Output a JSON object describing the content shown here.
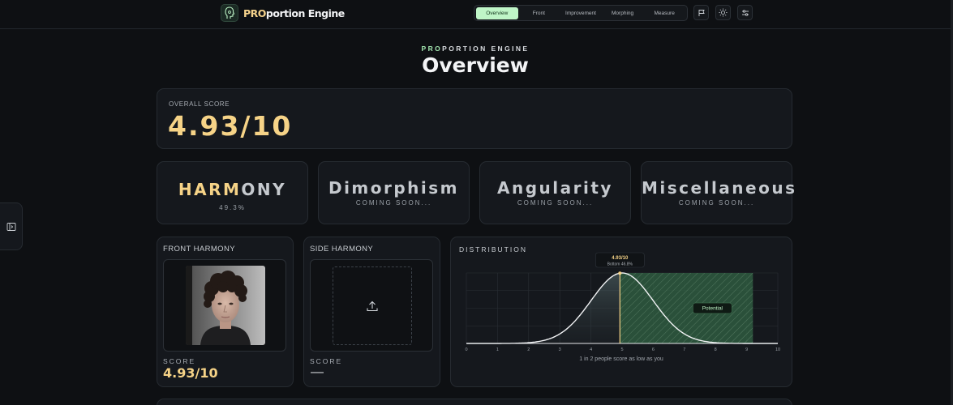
{
  "brand": {
    "prefix": "PRO",
    "rest": "portion Engine"
  },
  "nav": {
    "tabs": [
      {
        "label": "Overview",
        "active": true
      },
      {
        "label": "Front",
        "active": false
      },
      {
        "label": "Improvement",
        "active": false
      },
      {
        "label": "Morphing",
        "active": false
      },
      {
        "label": "Measure",
        "active": false
      }
    ]
  },
  "page": {
    "eyebrow_accent": "PRO",
    "eyebrow_rest": "PORTION ENGINE",
    "title": "Overview"
  },
  "overall": {
    "label": "OVERALL SCORE",
    "value": "4.93/10"
  },
  "metrics": {
    "harmony": {
      "title_left": "HARM",
      "title_right": "ONY",
      "value": "49.3%",
      "fill_percent": 49.3
    },
    "dimorphism": {
      "title": "Dimorphism",
      "subtitle": "COMING SOON..."
    },
    "angularity": {
      "title": "Angularity",
      "subtitle": "COMING SOON..."
    },
    "misc": {
      "title": "Miscellaneous",
      "subtitle": "COMING SOON..."
    }
  },
  "front": {
    "label": "FRONT HARMONY",
    "score_label": "SCORE",
    "score_value": "4.93/10"
  },
  "side": {
    "label": "SIDE HARMONY",
    "score_label": "SCORE",
    "score_value": "—"
  },
  "distribution": {
    "label": "DISTRIBUTION",
    "caption": "1 in 2 people score as low as you"
  },
  "colors": {
    "accent_gold": "#f6d387",
    "accent_green": "#bff5c7",
    "potential_green": "#2e5a3f"
  },
  "chart_data": {
    "type": "area",
    "x_ticks": [
      0,
      1,
      2,
      3,
      4,
      5,
      6,
      7,
      8,
      9,
      10
    ],
    "xlim": [
      0,
      10
    ],
    "distribution": {
      "mean": 5,
      "sd": 1.0
    },
    "marker": {
      "x": 4.93,
      "label": "4.93/10",
      "sublabel": "Bottom 46.8%"
    },
    "potential": {
      "from": 4.93,
      "to": 9.2,
      "label": "Potential"
    },
    "grid": true
  }
}
